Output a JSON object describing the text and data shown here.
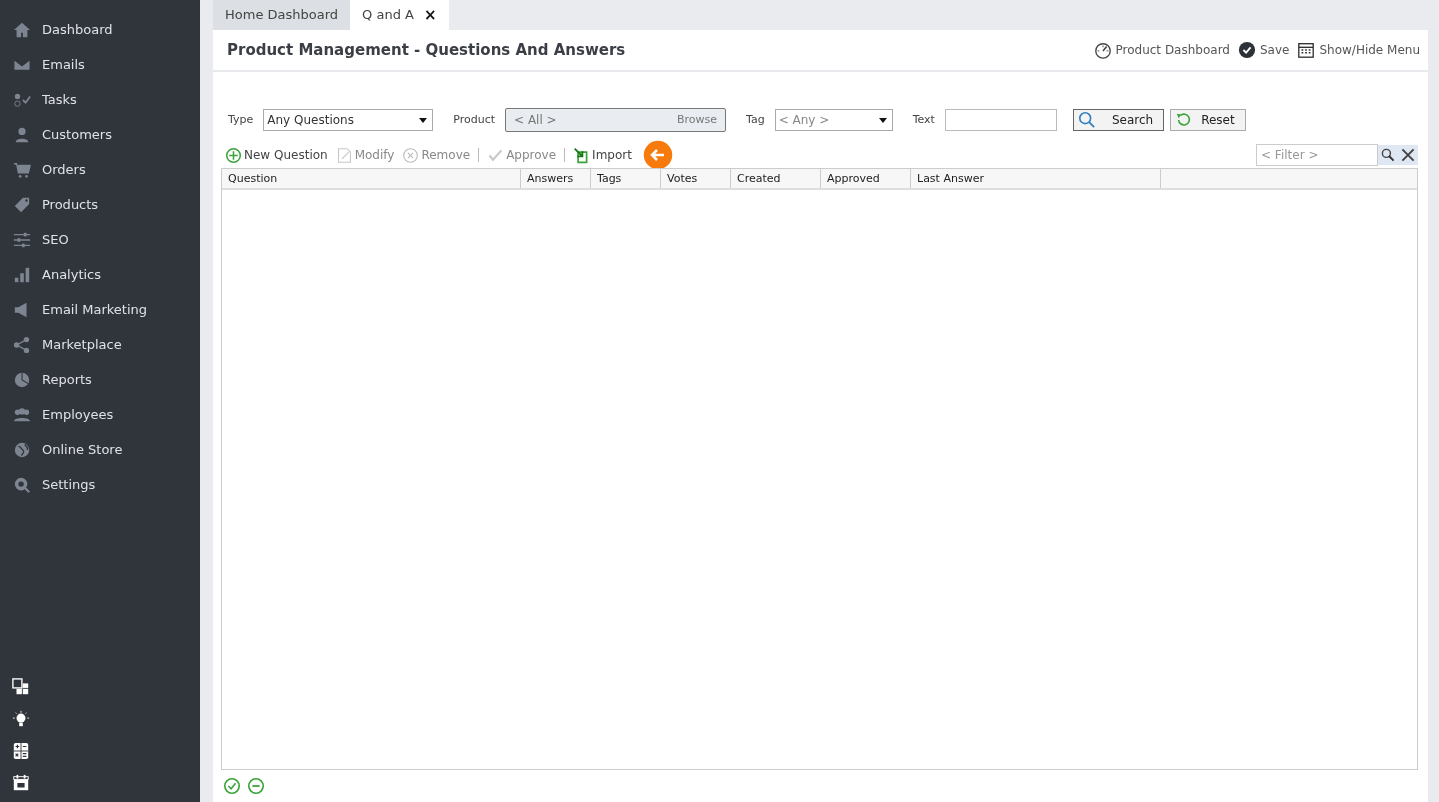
{
  "sidebar": {
    "items": [
      {
        "label": "Dashboard"
      },
      {
        "label": "Emails"
      },
      {
        "label": "Tasks"
      },
      {
        "label": "Customers"
      },
      {
        "label": "Orders"
      },
      {
        "label": "Products"
      },
      {
        "label": "SEO"
      },
      {
        "label": "Analytics"
      },
      {
        "label": "Email Marketing"
      },
      {
        "label": "Marketplace"
      },
      {
        "label": "Reports"
      },
      {
        "label": "Employees"
      },
      {
        "label": "Online Store"
      },
      {
        "label": "Settings"
      }
    ]
  },
  "tabs": [
    {
      "label": "Home Dashboard",
      "selected": false,
      "closable": false
    },
    {
      "label": "Q and A",
      "selected": true,
      "closable": true
    }
  ],
  "close_glyph": "×",
  "page": {
    "title": "Product Management - Questions And Answers",
    "actions": [
      {
        "label": "Product Dashboard"
      },
      {
        "label": "Save"
      },
      {
        "label": "Show/Hide Menu"
      }
    ]
  },
  "filters": {
    "type": {
      "label": "Type",
      "value": "Any Questions"
    },
    "product": {
      "label": "Product",
      "placeholder": "< All >",
      "browse": "Browse"
    },
    "tag": {
      "label": "Tag",
      "placeholder": "< Any >"
    },
    "text": {
      "label": "Text"
    },
    "search": "Search",
    "reset": "Reset"
  },
  "toolbar": [
    {
      "label": "New Question",
      "disabled": false
    },
    {
      "label": "Modify",
      "disabled": true
    },
    {
      "label": "Remove",
      "disabled": true
    },
    {
      "label": "Approve",
      "disabled": true
    },
    {
      "label": "Import",
      "disabled": false
    }
  ],
  "grid_filter": {
    "placeholder": "< Filter >"
  },
  "table": {
    "columns": [
      "Question",
      "Answers",
      "Tags",
      "Votes",
      "Created",
      "Approved",
      "Last Answer"
    ]
  }
}
